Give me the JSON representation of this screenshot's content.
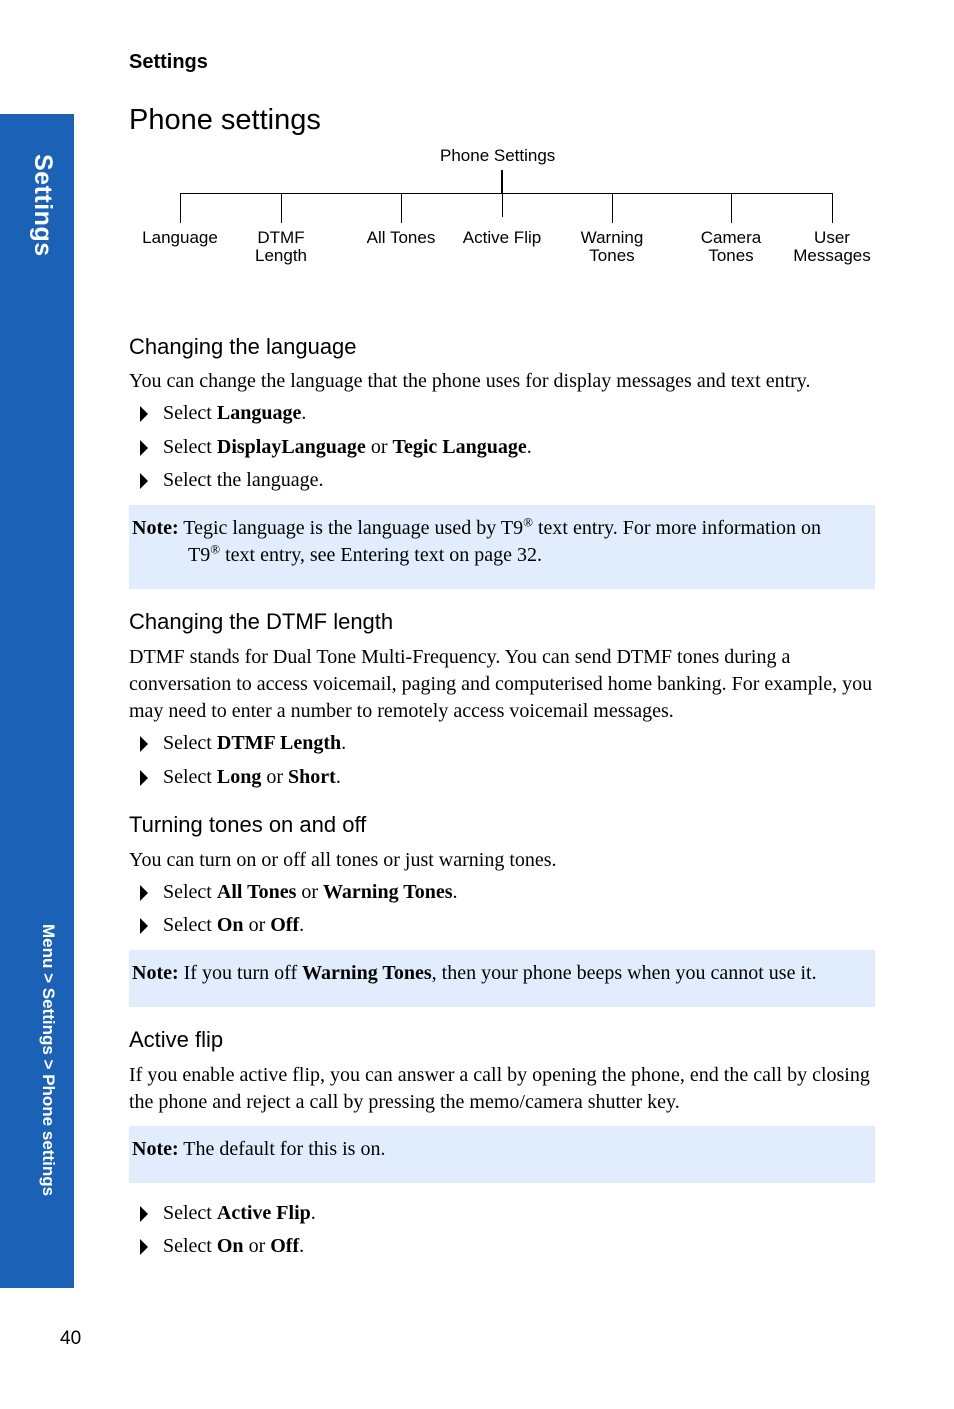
{
  "running_head": "Settings",
  "side_tab": {
    "title": "Settings",
    "breadcrumb": "Menu > Settings > Phone settings",
    "color": "#1b62b7"
  },
  "page_title": "Phone settings",
  "tree": {
    "root": "Phone Settings",
    "nodes": [
      {
        "line1": "Language",
        "line2": ""
      },
      {
        "line1": "DTMF",
        "line2": "Length"
      },
      {
        "line1": "All Tones",
        "line2": ""
      },
      {
        "line1": "Active Flip",
        "line2": ""
      },
      {
        "line1": "Warning",
        "line2": "Tones"
      },
      {
        "line1": "Camera",
        "line2": "Tones"
      },
      {
        "line1": "User",
        "line2": "Messages"
      }
    ]
  },
  "sections": {
    "language": {
      "heading": "Changing the language",
      "intro": "You can change the language that the phone uses for display messages and text entry.",
      "steps": [
        {
          "pre": "Select ",
          "bold1": "Language",
          "mid": "",
          "bold2": "",
          "post": "."
        },
        {
          "pre": "Select ",
          "bold1": "DisplayLanguage",
          "mid": " or ",
          "bold2": "Tegic Language",
          "post": "."
        },
        {
          "pre": "Select the language.",
          "bold1": "",
          "mid": "",
          "bold2": "",
          "post": ""
        }
      ],
      "note": {
        "label": "Note:",
        "text1": " Tegic language is the language used by T9",
        "sup1": "®",
        "text2": " text entry. For more information on",
        "text3": "T9",
        "sup2": "®",
        "text4": " text entry, see Entering text on page 32."
      }
    },
    "dtmf": {
      "heading": "Changing the DTMF length",
      "intro": "DTMF stands for Dual Tone Multi-Frequency. You can send DTMF tones during a conversation to access voicemail, paging and computerised home banking. For example, you may need to enter a number to remotely access voicemail messages.",
      "steps": [
        {
          "pre": "Select ",
          "bold1": "DTMF Length",
          "mid": "",
          "bold2": "",
          "post": "."
        },
        {
          "pre": "Select ",
          "bold1": "Long",
          "mid": " or ",
          "bold2": "Short",
          "post": "."
        }
      ]
    },
    "tones": {
      "heading": "Turning tones on and off",
      "intro": "You can turn on or off all tones or just warning tones.",
      "steps": [
        {
          "pre": "Select ",
          "bold1": "All Tones",
          "mid": " or ",
          "bold2": "Warning Tones",
          "post": "."
        },
        {
          "pre": "Select ",
          "bold1": "On",
          "mid": " or ",
          "bold2": "Off",
          "post": "."
        }
      ],
      "note": {
        "label": "Note:",
        "text1": " If you turn off ",
        "bold": "Warning Tones",
        "text2": ", then your phone beeps when you cannot use it."
      }
    },
    "flip": {
      "heading": "Active flip",
      "intro": "If you enable active flip, you can answer a call by opening the phone, end the call by closing the phone and reject a call by pressing the memo/camera shutter key.",
      "note": {
        "label": "Note:",
        "text": " The default for this is on."
      },
      "steps": [
        {
          "pre": "Select ",
          "bold1": "Active Flip",
          "mid": "",
          "bold2": "",
          "post": "."
        },
        {
          "pre": "Select ",
          "bold1": "On",
          "mid": " or ",
          "bold2": "Off",
          "post": "."
        }
      ]
    }
  },
  "page_number": "40"
}
